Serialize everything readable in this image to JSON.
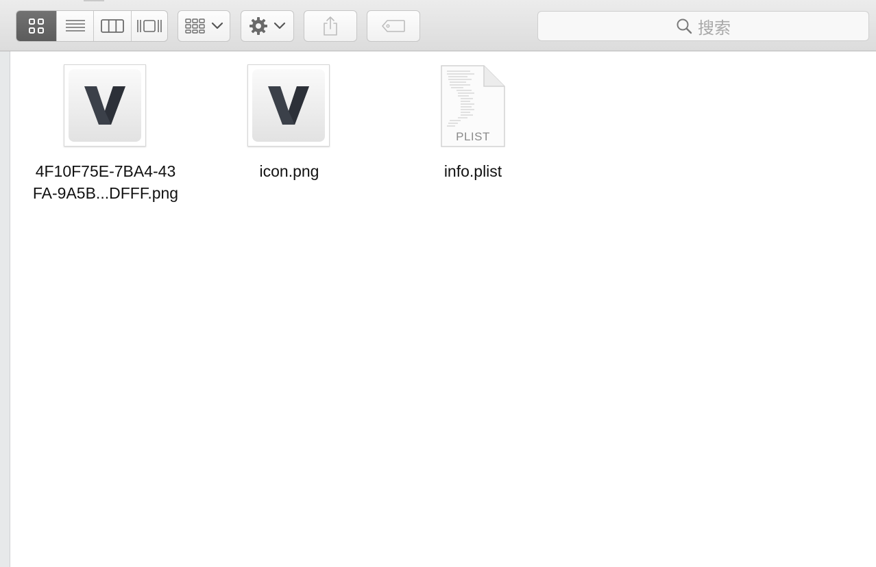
{
  "toolbar": {
    "view_modes": [
      {
        "name": "icon-view",
        "icon": "grid-icon",
        "active": true
      },
      {
        "name": "list-view",
        "icon": "list-icon",
        "active": false
      },
      {
        "name": "column-view",
        "icon": "columns-icon",
        "active": false
      },
      {
        "name": "cover-flow-view",
        "icon": "cover-flow-icon",
        "active": false
      }
    ],
    "group_button_icon": "group-grid-icon",
    "action_button_icon": "gear-icon",
    "share_button_icon": "share-icon",
    "tag_button_icon": "tag-icon",
    "search": {
      "placeholder": "搜索",
      "icon": "search-icon"
    }
  },
  "files": [
    {
      "line1": "4F10F75E-7BA4-43",
      "line2": "FA-9A5B...DFFF.png",
      "type": "png"
    },
    {
      "line1": "icon.png",
      "line2": "",
      "type": "png"
    },
    {
      "line1": "info.plist",
      "line2": "",
      "type": "plist",
      "doc_label": "PLIST"
    }
  ],
  "colors": {
    "active_segment": "#666666",
    "icon_gray": "#6a6a6a",
    "logo_dark": "#3b4049"
  }
}
